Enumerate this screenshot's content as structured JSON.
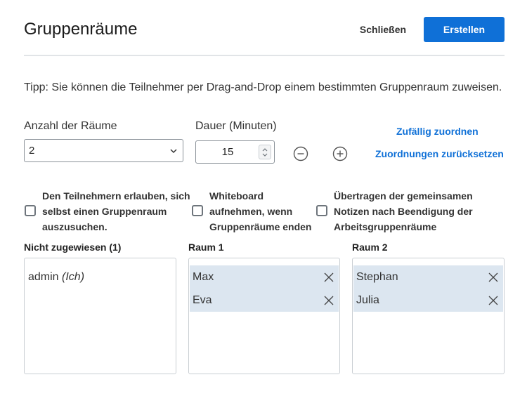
{
  "header": {
    "title": "Gruppenräume",
    "close_label": "Schließen",
    "create_label": "Erstellen"
  },
  "tip": "Tipp: Sie können die Teilnehmer per Drag-and-Drop einem bestimmten Gruppenraum zuweisen.",
  "room_count": {
    "label": "Anzahl der Räume",
    "value": "2"
  },
  "duration": {
    "label": "Dauer (Minuten)",
    "value": "15"
  },
  "links": {
    "random_assign": "Zufällig zuordnen",
    "reset_assign": "Zuordnungen zurücksetzen"
  },
  "options": [
    {
      "lines": [
        "Den Teilnehmern erlauben, sich",
        "selbst einen Gruppenraum",
        "auszusuchen."
      ],
      "checked": false
    },
    {
      "lines": [
        "Whiteboard",
        "aufnehmen, wenn",
        "Gruppenräume enden"
      ],
      "checked": false
    },
    {
      "lines": [
        "Übertragen der gemeinsamen",
        "Notizen nach Beendigung der",
        "Arbeitsgruppenräume"
      ],
      "checked": false
    }
  ],
  "rooms": {
    "unassigned": {
      "title": "Nicht zugewiesen (1)",
      "items": [
        {
          "name": "admin",
          "note": "(Ich)"
        }
      ]
    },
    "room1": {
      "title": "Raum 1",
      "items": [
        {
          "name": "Max"
        },
        {
          "name": "Eva"
        }
      ]
    },
    "room2": {
      "title": "Raum 2",
      "items": [
        {
          "name": "Stephan"
        },
        {
          "name": "Julia"
        }
      ]
    }
  },
  "colors": {
    "accent": "#0f70d7",
    "assigned_item_bg": "#dce6f0",
    "divider": "#e1e4e7"
  },
  "icons": {
    "chevron": "chevron-down-icon",
    "minus": "minus-circle-icon",
    "plus": "plus-circle-icon",
    "remove": "close-icon"
  }
}
